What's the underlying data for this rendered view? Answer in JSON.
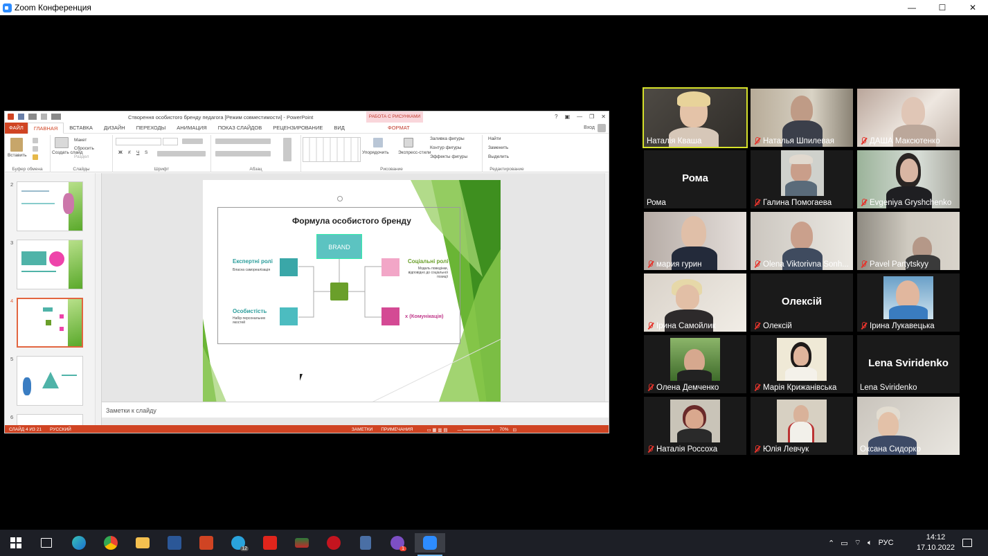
{
  "zoom": {
    "title": "Zoom Конференция",
    "win_minimize": "—",
    "win_maximize": "☐",
    "win_close": "✕"
  },
  "ppt": {
    "doc_title": "Створення особистого бренду педагога [Режим совместимости] - PowerPoint",
    "context_tab": "РАБОТА С РИСУНКАМИ",
    "help": "?",
    "tabs": [
      "ФАЙЛ",
      "ГЛАВНАЯ",
      "ВСТАВКА",
      "ДИЗАЙН",
      "ПЕРЕХОДЫ",
      "АНИМАЦИЯ",
      "ПОКАЗ СЛАЙДОВ",
      "РЕЦЕНЗИРОВАНИЕ",
      "ВИД"
    ],
    "format_tab": "ФОРМАТ",
    "signin": "Вход",
    "ribbon": {
      "paste": "Вставить",
      "clipboard_group": "Буфер обмена",
      "new_slide": "Создать слайд",
      "layout": "Макет",
      "reset": "Сбросить",
      "section": "Раздел",
      "slides_group": "Слайды",
      "font_group": "Шрифт",
      "paragraph_group": "Абзац",
      "arrange": "Упорядочить",
      "quick_styles": "Экспресс-стили",
      "shape_fill": "Заливка фигуры",
      "shape_outline": "Контур фигуры",
      "shape_effects": "Эффекты фигуры",
      "drawing_group": "Рисование",
      "find": "Найти",
      "replace": "Заменить",
      "select": "Выделить",
      "editing_group": "Редактирование"
    },
    "thumbs": [
      {
        "num": "2"
      },
      {
        "num": "3"
      },
      {
        "num": "4"
      },
      {
        "num": "5"
      },
      {
        "num": "6"
      }
    ],
    "slide": {
      "title": "Формула особистого бренду",
      "brand": "BRAND",
      "expert_title": "Експертні ролі",
      "expert_sub": "Власна самореалізація",
      "social_title": "Соціальні ролі",
      "social_sub": "Модель поведінки, відповідно до соціальної позиції",
      "personality_title": "Особистість",
      "personality_sub": "Набір персональних якостей",
      "communication_title": "х (Комунікація)"
    },
    "notes_placeholder": "Заметки к слайду",
    "status": {
      "slide_of": "СЛАЙД 4 ИЗ 21",
      "language": "РУССКИЙ",
      "notes": "ЗАМЕТКИ",
      "comments": "ПРИМЕЧАНИЯ",
      "zoom": "70%"
    }
  },
  "participants": [
    {
      "name": "Наталія Кваша",
      "muted": false,
      "active": true,
      "video": true
    },
    {
      "name": "Наталья Шпилевая",
      "muted": true,
      "video": true
    },
    {
      "name": "ДАША Максютенко",
      "muted": true,
      "video": true
    },
    {
      "name": "Рома",
      "muted": false,
      "video": false,
      "display": "Рома"
    },
    {
      "name": "Галина Помогаева",
      "muted": true,
      "video": true
    },
    {
      "name": "Evgeniya Gryshchenko",
      "muted": true,
      "video": true
    },
    {
      "name": "мария гурин",
      "muted": true,
      "video": true
    },
    {
      "name": "Olena Viktorivna Sonh...",
      "muted": true,
      "video": true
    },
    {
      "name": "Pavel Partytskyy",
      "muted": true,
      "video": true
    },
    {
      "name": "Ірина Самойлик",
      "muted": true,
      "video": true
    },
    {
      "name": "Олексій",
      "muted": true,
      "video": false,
      "display": "Олексій"
    },
    {
      "name": "Ірина Лукавецька",
      "muted": true,
      "video": true
    },
    {
      "name": "Олена Демченко",
      "muted": true,
      "video": true
    },
    {
      "name": "Марія Крижанівська",
      "muted": true,
      "video": true
    },
    {
      "name": "Lena Sviridenko",
      "muted": false,
      "video": false,
      "display": "Lena Sviridenko"
    },
    {
      "name": "Наталія Россоха",
      "muted": true,
      "video": true
    },
    {
      "name": "Юлія Левчук",
      "muted": true,
      "video": true
    },
    {
      "name": "Оксана Сидорко",
      "muted": false,
      "video": true
    }
  ],
  "taskbar": {
    "apps": [
      "start-icon",
      "task-view-icon",
      "edge-icon",
      "chrome-icon",
      "explorer-icon",
      "word-icon",
      "powerpoint-icon",
      "telegram-icon",
      "acrobat-icon",
      "media-icon",
      "opera-icon",
      "calculator-icon",
      "viber-icon",
      "zoom-icon"
    ],
    "telegram_badge": "12",
    "viber_badge": "1",
    "language": "РУС",
    "time": "14:12",
    "date": "17.10.2022"
  }
}
